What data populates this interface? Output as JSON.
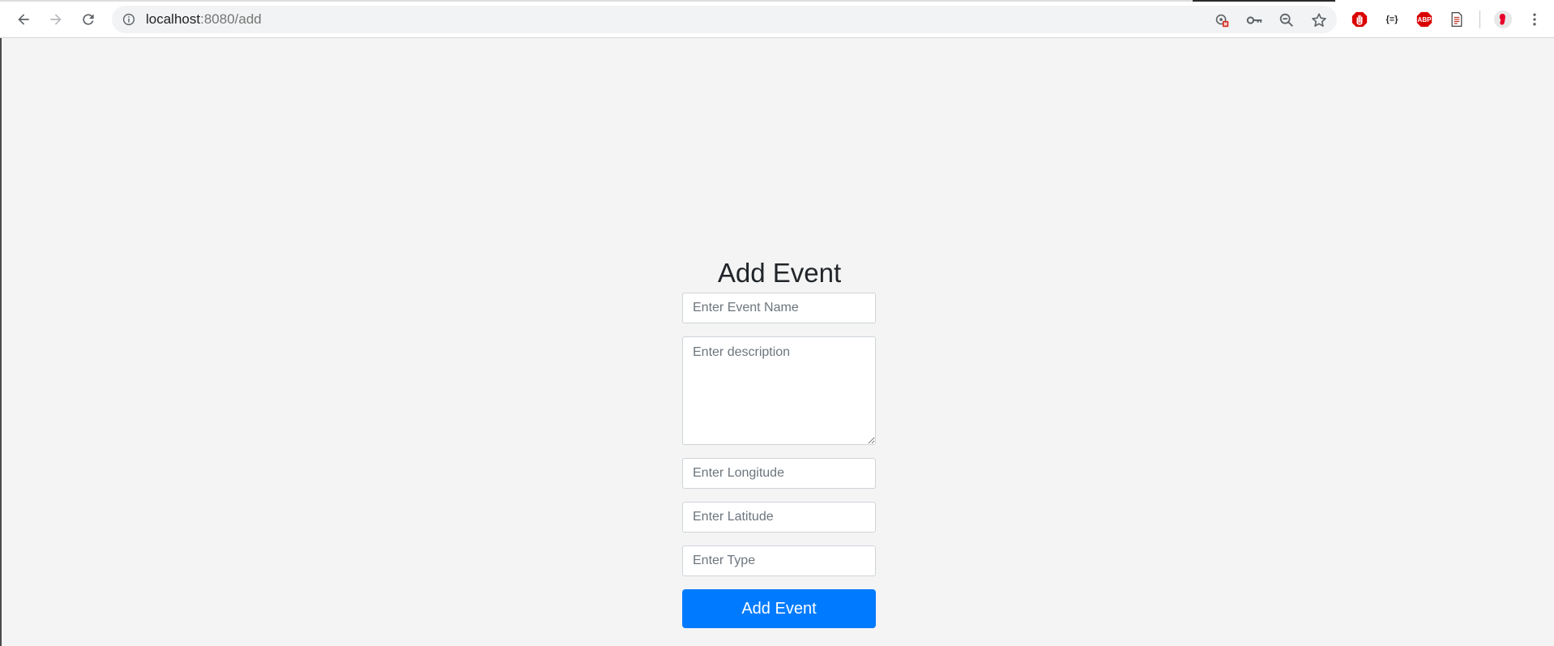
{
  "browser": {
    "url_host": "localhost",
    "url_rest": ":8080/add",
    "icons": {
      "back": "back-arrow-icon",
      "forward": "forward-arrow-icon",
      "reload": "reload-icon",
      "info": "info-icon",
      "blocked_content": "blocked-content-icon",
      "password": "key-icon",
      "zoom": "zoom-out-icon",
      "bookmark": "star-icon",
      "ext1": "stop-hand-extension-icon",
      "ext2": "json-viewer-extension-icon",
      "ext3": "adblock-plus-extension-icon",
      "ext4": "document-extension-icon",
      "profile": "profile-avatar-icon",
      "menu": "kebab-menu-icon"
    },
    "ext3_text": "ABP",
    "ext2_text": "{≡}"
  },
  "form": {
    "title": "Add Event",
    "fields": {
      "name_placeholder": "Enter Event Name",
      "description_placeholder": "Enter description",
      "longitude_placeholder": "Enter Longitude",
      "latitude_placeholder": "Enter Latitude",
      "type_placeholder": "Enter Type"
    },
    "submit_label": "Add Event"
  },
  "colors": {
    "primary": "#007bff",
    "page_background": "#f4f4f4",
    "abp_red": "#d90000"
  }
}
